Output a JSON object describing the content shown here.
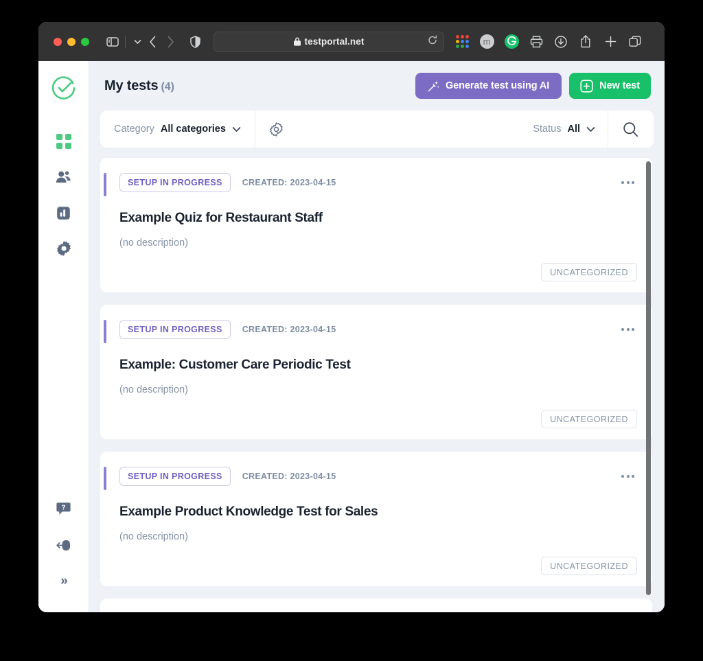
{
  "browser": {
    "traffic_lights": [
      "close",
      "minimize",
      "maximize"
    ],
    "sidebar_toggle_icon": "sidebar-icon",
    "tab_overview_icon": "chevron-down-icon",
    "back_icon": "chevron-left-icon",
    "forward_icon": "chevron-right-icon",
    "shield_icon": "shield-icon",
    "address": {
      "lock_icon": "lock-icon",
      "url": "testportal.net",
      "reload_icon": "reload-icon"
    },
    "toolbar_icons": [
      "extensions-grid-icon",
      "profile-avatar-m",
      "grammarly-icon",
      "print-icon",
      "downloads-icon",
      "share-icon",
      "new-tab-icon",
      "tab-overview-icon"
    ],
    "avatar_letter": "m",
    "grammarly_letter": "G"
  },
  "sidebar": {
    "logo_icon": "check-circle-logo",
    "items": [
      {
        "icon": "grid-icon",
        "name": "dashboard",
        "active": true
      },
      {
        "icon": "people-icon",
        "name": "candidates",
        "active": false
      },
      {
        "icon": "chart-icon",
        "name": "reports",
        "active": false
      },
      {
        "icon": "gear-icon",
        "name": "settings",
        "active": false
      }
    ],
    "bottom_items": [
      {
        "icon": "help-icon",
        "name": "help"
      },
      {
        "icon": "logout-icon",
        "name": "logout"
      },
      {
        "icon": "expand-icon",
        "name": "expand-sidebar",
        "glyph": "»"
      }
    ]
  },
  "header": {
    "title": "My tests",
    "count": "(4)",
    "generate_ai_button": {
      "label": "Generate test using AI",
      "icon": "magic-wand-icon",
      "color": "#7c6cc4"
    },
    "new_test_button": {
      "label": "New test",
      "icon": "plus-square-icon",
      "color": "#18c069"
    }
  },
  "filters": {
    "category_label": "Category",
    "category_value": "All categories",
    "category_caret": "chevron-down-icon",
    "settings_icon": "gear-icon",
    "status_label": "Status",
    "status_value": "All",
    "status_caret": "chevron-down-icon",
    "search_icon": "search-icon"
  },
  "tests": [
    {
      "status_badge": "SETUP IN PROGRESS",
      "created": "CREATED: 2023-04-15",
      "title": "Example Quiz for Restaurant Staff",
      "description": "(no description)",
      "category": "UNCATEGORIZED",
      "menu_icon": "more-horizontal-icon"
    },
    {
      "status_badge": "SETUP IN PROGRESS",
      "created": "CREATED: 2023-04-15",
      "title": "Example: Customer Care Periodic Test",
      "description": "(no description)",
      "category": "UNCATEGORIZED",
      "menu_icon": "more-horizontal-icon"
    },
    {
      "status_badge": "SETUP IN PROGRESS",
      "created": "CREATED: 2023-04-15",
      "title": "Example Product Knowledge Test for Sales",
      "description": "(no description)",
      "category": "UNCATEGORIZED",
      "menu_icon": "more-horizontal-icon"
    }
  ],
  "colors": {
    "accent_purple": "#8b7fd4",
    "brand_green": "#18c069",
    "page_bg": "#eef2f6",
    "card_bg": "#ffffff",
    "chrome_bg": "#333333"
  }
}
